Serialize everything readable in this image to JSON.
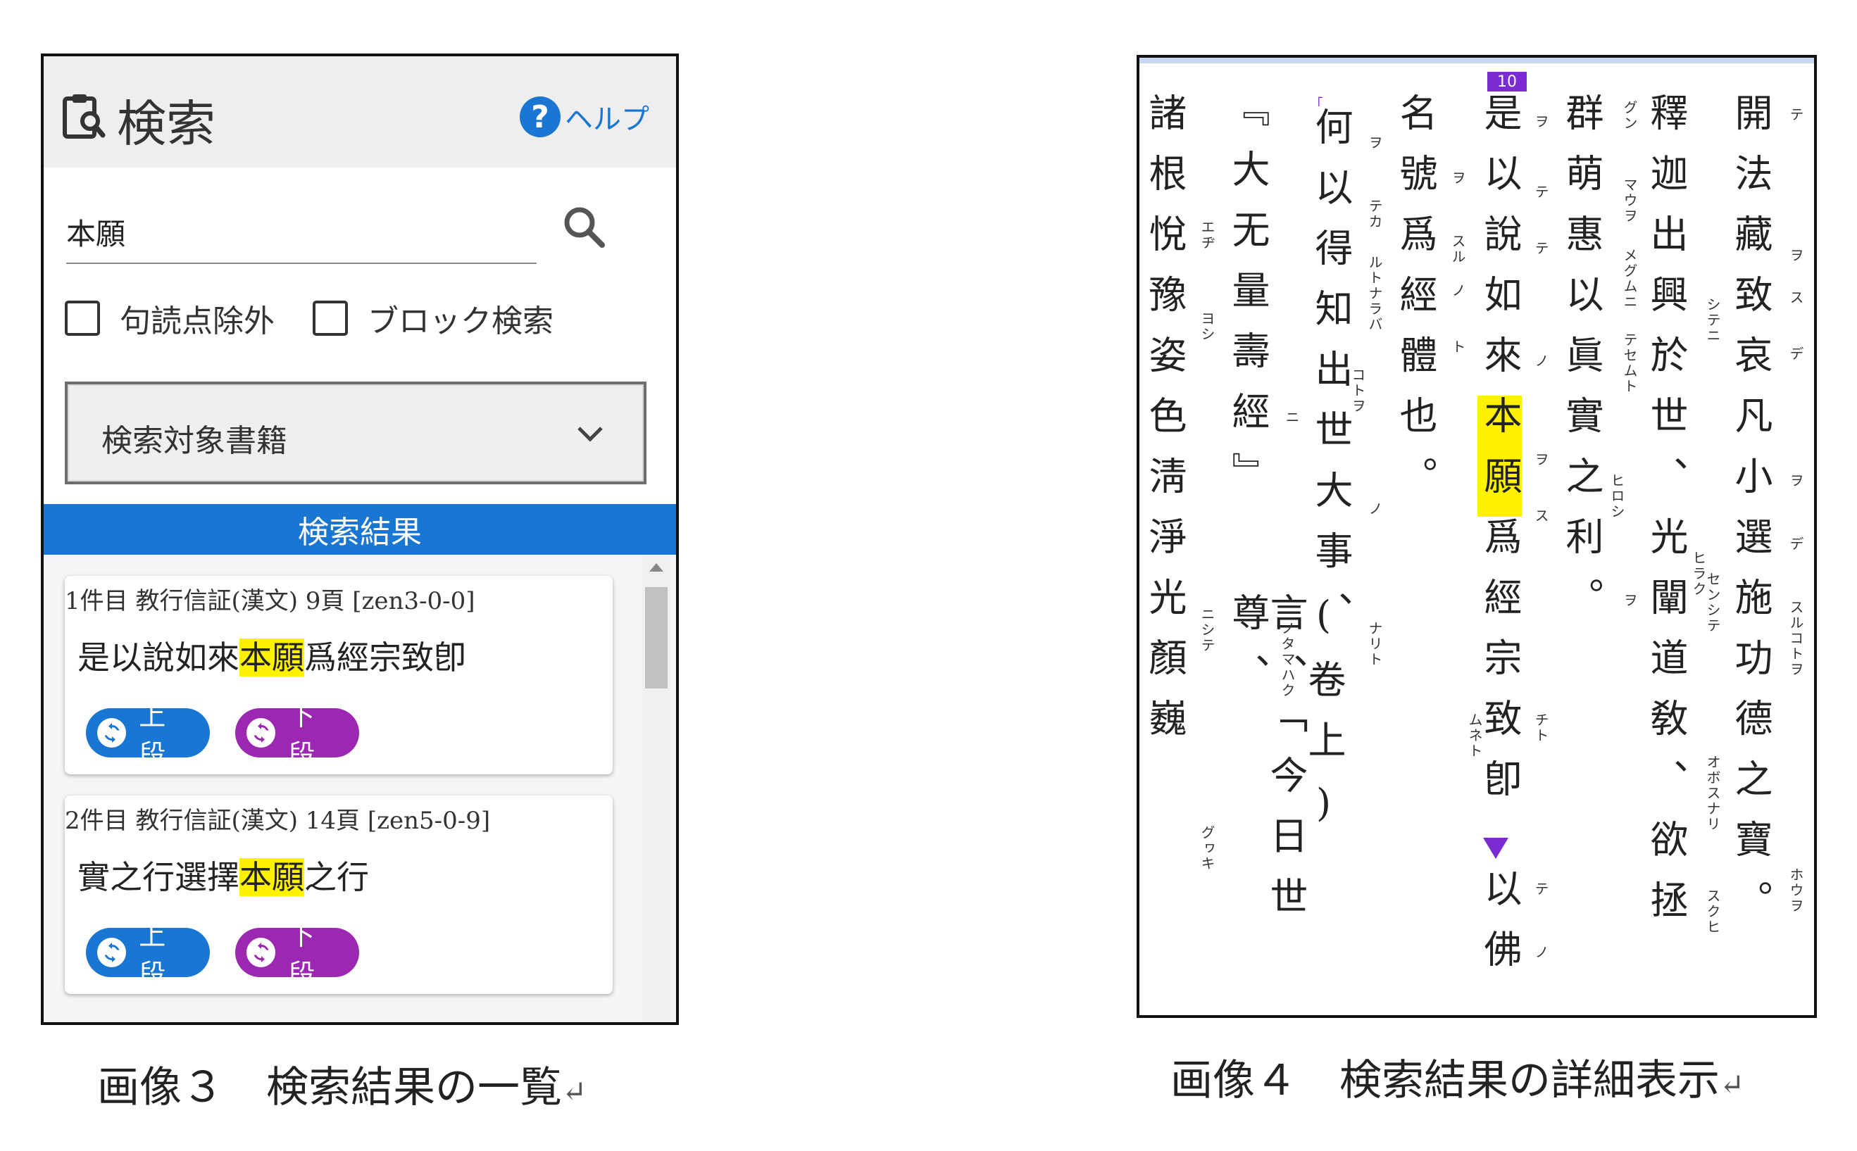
{
  "search_panel": {
    "title": "検索",
    "help_label": "ヘルプ",
    "search_value": "本願",
    "checkboxes": [
      {
        "label": "句読点除外",
        "checked": false
      },
      {
        "label": "ブロック検索",
        "checked": false
      }
    ],
    "book_select_label": "検索対象書籍",
    "results_header": "検索結果",
    "results": [
      {
        "meta": "1件目 教行信証(漢文) 9頁 [zen3-0-0]",
        "text_before": "是以說如來",
        "text_match": "本願",
        "text_after": "爲經宗致卽",
        "upper_label": "上段",
        "lower_label": "下段"
      },
      {
        "meta": "2件目 教行信証(漢文) 14頁 [zen5-0-9]",
        "text_before": "實之行選擇",
        "text_match": "本願",
        "text_after": "之行",
        "upper_label": "上段",
        "lower_label": "下段"
      }
    ],
    "colors": {
      "accent": "#1976d2",
      "lower": "#9c27b0",
      "highlight": "#fff200"
    }
  },
  "captions": {
    "left": "画像３　検索結果の一覧",
    "right": "画像４　検索結果の詳細表示",
    "return_mark": "↵"
  },
  "detail_panel": {
    "page_badge": "10",
    "pin": "꜒",
    "columns": [
      "開法藏致哀凡小選施功德之寶。",
      "釋迦出興於世、光闡道敎、欲拯",
      "群萌惠以眞實之利。",
      "是以說如來本願爲經宗致卽以佛",
      "名號爲經體也。",
      "何以得知出世大事、",
      "『大无量壽經』",
      "(卷上) 言、「今日世尊、",
      "諸根悅豫姿色淸淨光顏巍"
    ],
    "highlight_column_before": "是以說如來",
    "highlight_column_match": "本願",
    "highlight_column_after": "爲經宗致卽",
    "highlight_column_tail": "以佛",
    "ruby": [
      "テ",
      "ヲ",
      "ス",
      "デ",
      "ヲ",
      "デ",
      "スルコトヲ",
      "ホウヲ",
      "シテニ",
      "センシテ",
      "ヒラク",
      "オボスナリ",
      "スクヒ",
      "グン",
      "マウヲ",
      "メグムニ",
      "テセムト",
      "ヒロシ",
      "ヲ",
      "ヲ",
      "テ",
      "テ",
      "ノ",
      "ヲ",
      "ス",
      "チト",
      "ムネト",
      "テ",
      "ノ",
      "ヲ",
      "スル",
      "ノ",
      "ト",
      "ヲ",
      "テカ",
      "ルトナラバ",
      "コトヲ",
      "ノ",
      "ナリト",
      "ニ",
      "ノタマハク",
      "エヂ",
      "ヨシ",
      "ニシテ",
      "グヮキ"
    ]
  }
}
